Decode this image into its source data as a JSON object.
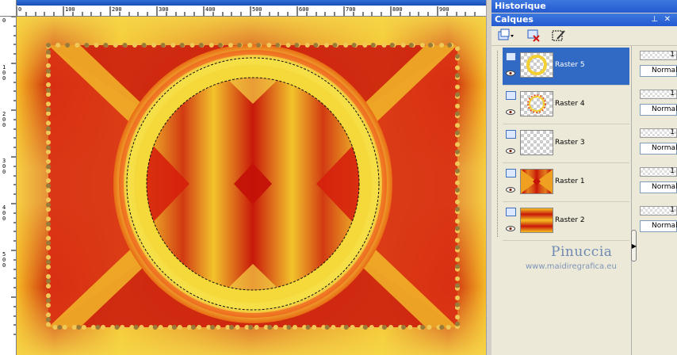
{
  "ruler": {
    "top_labels": [
      "0",
      "100",
      "200",
      "300",
      "400",
      "500",
      "600",
      "700",
      "800",
      "900"
    ],
    "left_labels": [
      "0",
      "1 0 0",
      "2 0 0",
      "3 0 0",
      "4 0 0",
      "5 0 0"
    ]
  },
  "panels": {
    "historique_title": "Historique",
    "calques_title": "Calques",
    "pin_icon": "pin-icon",
    "close_icon": "close-icon"
  },
  "layers": [
    {
      "name": "Raster 5",
      "selected": true,
      "thumb": "ring-thumb",
      "opacity": "1",
      "blend": "Normal"
    },
    {
      "name": "Raster 4",
      "selected": false,
      "thumb": "dotted-ring-thumb",
      "opacity": "1",
      "blend": "Normal"
    },
    {
      "name": "Raster 3",
      "selected": false,
      "thumb": "empty-thumb",
      "opacity": "1",
      "blend": "Normal"
    },
    {
      "name": "Raster 1",
      "selected": false,
      "thumb": "pattern-thumb",
      "opacity": "1",
      "blend": "Normal"
    },
    {
      "name": "Raster 2",
      "selected": false,
      "thumb": "gradient-thumb",
      "opacity": "1",
      "blend": "Normal"
    }
  ],
  "watermark": {
    "title": "Pinuccia",
    "url": "www.maidiregrafica.eu"
  },
  "colors": {
    "accent": "#316ac5",
    "canvas_red": "#c8180a",
    "canvas_yellow": "#f5d020"
  }
}
